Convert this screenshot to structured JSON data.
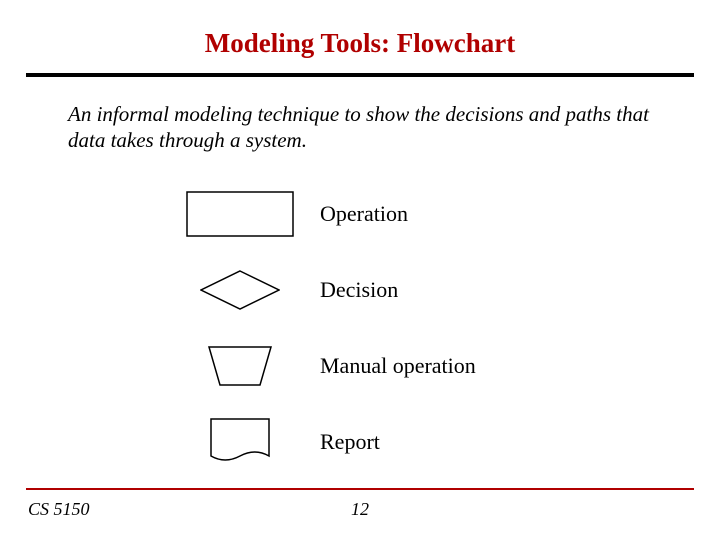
{
  "title": "Modeling Tools: Flowchart",
  "description": "An informal modeling technique to show the decisions and paths that data takes through a system.",
  "legend": [
    {
      "label": "Operation"
    },
    {
      "label": "Decision"
    },
    {
      "label": "Manual operation"
    },
    {
      "label": "Report"
    }
  ],
  "footer": {
    "course": "CS 5150",
    "page": "12"
  }
}
